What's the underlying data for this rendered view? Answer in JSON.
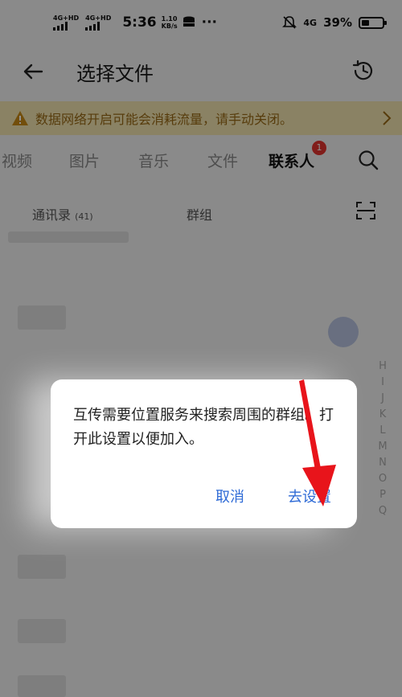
{
  "status_bar": {
    "sim1_label": "4G+HD",
    "sim2_label": "4G+HD",
    "time": "5:36",
    "net_speed_value": "1.10",
    "net_speed_unit": "KB/s",
    "more": "···",
    "network": "4G",
    "battery": "39%",
    "battery_level": 0.39
  },
  "header": {
    "title": "选择文件",
    "back_icon": "arrow-left-icon",
    "history_icon": "history-clock-icon"
  },
  "warning": {
    "text": "数据网络开启可能会消耗流量，请手动关闭。",
    "color": "#f3e5b0"
  },
  "tabs": {
    "items": [
      "视频",
      "图片",
      "音乐",
      "文件",
      "联系人"
    ],
    "active": "联系人",
    "badge": "1"
  },
  "subtabs": {
    "contacts_label": "通讯录",
    "contacts_count": "(41)",
    "groups_label": "群组"
  },
  "alphabet_index": [
    "H",
    "I",
    "J",
    "K",
    "L",
    "M",
    "N",
    "O",
    "P",
    "Q"
  ],
  "dialog": {
    "message": "互传需要位置服务来搜索周围的群组。打开此设置以便加入。",
    "cancel_label": "取消",
    "confirm_label": "去设置",
    "accent_color": "#2f6bd6"
  },
  "annotation": {
    "arrow_color": "#e8141b"
  }
}
